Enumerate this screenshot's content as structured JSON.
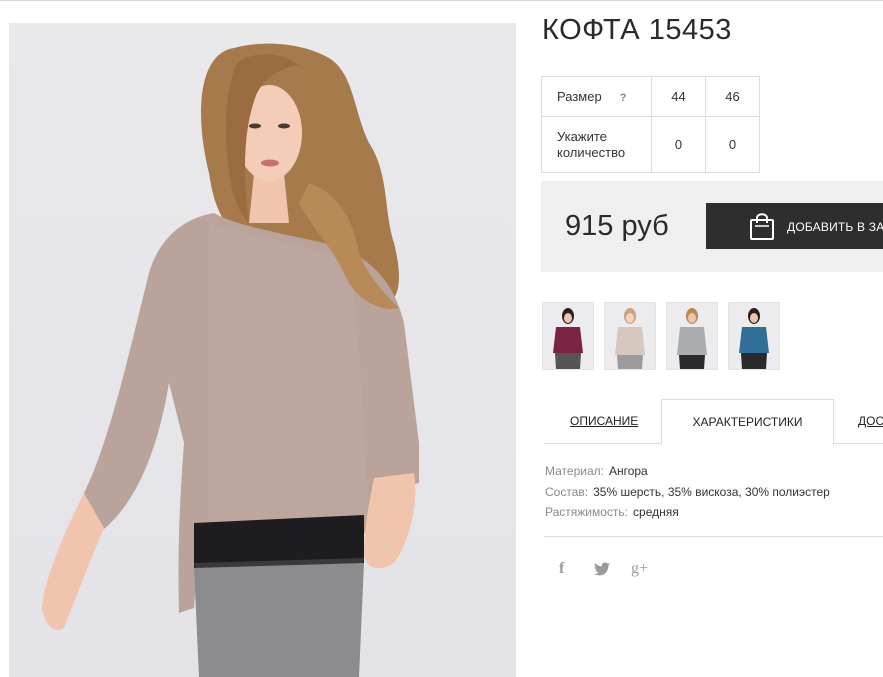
{
  "product": {
    "title": "КОФТА 15453",
    "size_table": {
      "size_label": "Размер",
      "help_icon": "?",
      "sizes": [
        "44",
        "46"
      ],
      "qty_label_line1": "Укажите",
      "qty_label_line2": "количество",
      "quantities": [
        "0",
        "0"
      ]
    },
    "price": "915 руб",
    "add_to_cart_label": "ДОБАВИТЬ В ЗА",
    "icons": {
      "cart": "shopping-bag-icon"
    }
  },
  "thumbnails": [
    {
      "name": "thumb-burgundy",
      "color": "#7b2344"
    },
    {
      "name": "thumb-beige",
      "color": "#d6c8bf"
    },
    {
      "name": "thumb-grey",
      "color": "#a9adb0"
    },
    {
      "name": "thumb-blue",
      "color": "#2f6f98"
    }
  ],
  "tabs": {
    "description": "ОПИСАНИЕ",
    "characteristics": "ХАРАКТЕРИСТИКИ",
    "delivery": "ДОС"
  },
  "characteristics": [
    {
      "key": "Материал:",
      "value": "Ангора"
    },
    {
      "key": "Состав:",
      "value": "35% шерсть, 35% вискоза, 30% полиэстер"
    },
    {
      "key": "Растяжимость:",
      "value": "средняя"
    }
  ],
  "social": {
    "facebook": "f",
    "twitter": "twitter-icon",
    "google_plus": "g+"
  },
  "colors": {
    "sweater": "#b9a39b",
    "pants": "#8c8c8e",
    "button_bg": "#2e2e2e"
  }
}
